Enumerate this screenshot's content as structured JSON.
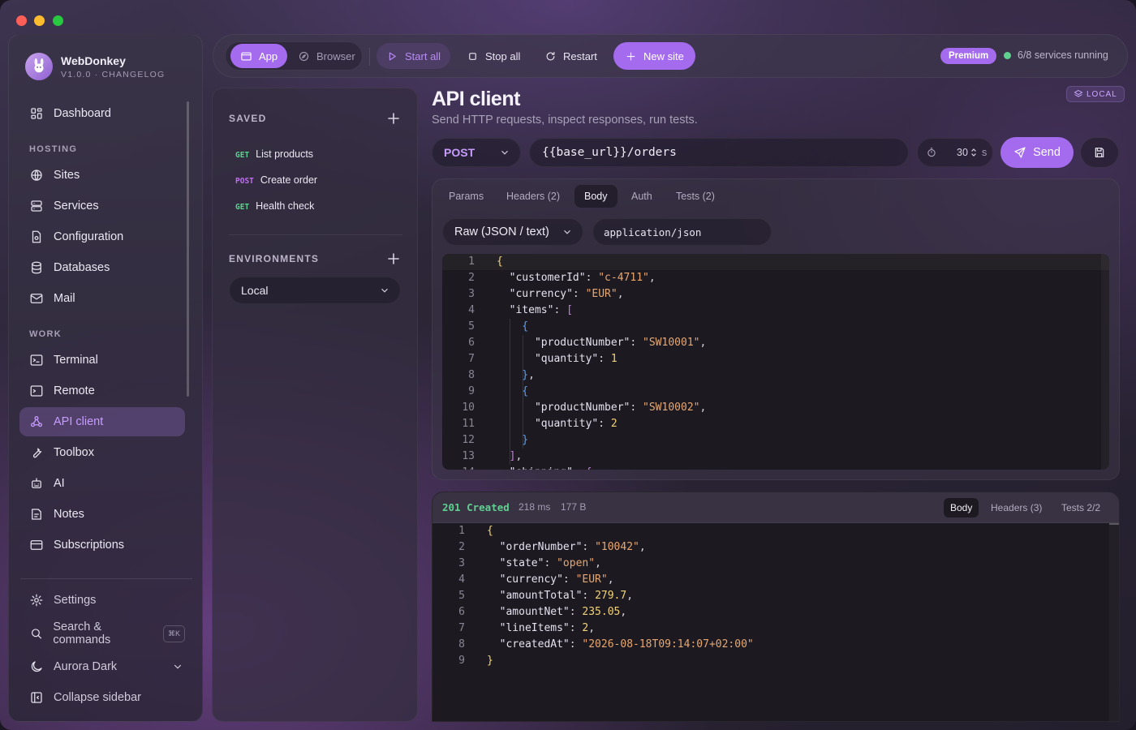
{
  "app": {
    "name": "WebDonkey",
    "version": "V1.0.0 · CHANGELOG"
  },
  "sidebar": {
    "dashboard": "Dashboard",
    "hosting_label": "HOSTING",
    "hosting": [
      "Sites",
      "Services",
      "Configuration",
      "Databases",
      "Mail"
    ],
    "work_label": "WORK",
    "work": [
      "Terminal",
      "Remote",
      "API client",
      "Toolbox",
      "AI",
      "Notes",
      "Subscriptions"
    ],
    "settings": "Settings",
    "search": "Search & commands",
    "search_kbd": "⌘K",
    "theme": "Aurora Dark",
    "collapse": "Collapse sidebar"
  },
  "toolbar": {
    "app": "App",
    "browser": "Browser",
    "start_all": "Start all",
    "stop_all": "Stop all",
    "restart": "Restart",
    "new_site": "New site",
    "premium": "Premium",
    "status": "6/8 services running"
  },
  "saved": {
    "label": "SAVED",
    "items": [
      {
        "method": "GET",
        "name": "List products"
      },
      {
        "method": "POST",
        "name": "Create order"
      },
      {
        "method": "GET",
        "name": "Health check"
      }
    ],
    "env_label": "ENVIRONMENTS",
    "env_value": "Local"
  },
  "page": {
    "title": "API client",
    "subtitle": "Send HTTP requests, inspect responses, run tests.",
    "badge": "LOCAL"
  },
  "request": {
    "method": "POST",
    "url": "{{base_url}}/orders",
    "timeout": "30",
    "timeout_unit": "s",
    "send": "Send",
    "tabs": [
      "Params",
      "Headers (2)",
      "Body",
      "Auth",
      "Tests (2)"
    ],
    "active_tab": "Body",
    "body_type": "Raw (JSON / text)",
    "content_type": "application/json",
    "body_lines": [
      [
        {
          "c": "b1",
          "t": "{"
        }
      ],
      [
        {
          "c": "k",
          "t": "  \"customerId\""
        },
        {
          "c": "p",
          "t": ": "
        },
        {
          "c": "s",
          "t": "\"c-4711\""
        },
        {
          "c": "p",
          "t": ","
        }
      ],
      [
        {
          "c": "k",
          "t": "  \"currency\""
        },
        {
          "c": "p",
          "t": ": "
        },
        {
          "c": "s",
          "t": "\"EUR\""
        },
        {
          "c": "p",
          "t": ","
        }
      ],
      [
        {
          "c": "k",
          "t": "  \"items\""
        },
        {
          "c": "p",
          "t": ": "
        },
        {
          "c": "b2",
          "t": "["
        }
      ],
      [
        {
          "c": "b3",
          "t": "    {"
        }
      ],
      [
        {
          "c": "k",
          "t": "      \"productNumber\""
        },
        {
          "c": "p",
          "t": ": "
        },
        {
          "c": "s",
          "t": "\"SW10001\""
        },
        {
          "c": "p",
          "t": ","
        }
      ],
      [
        {
          "c": "k",
          "t": "      \"quantity\""
        },
        {
          "c": "p",
          "t": ": "
        },
        {
          "c": "n",
          "t": "1"
        }
      ],
      [
        {
          "c": "b3",
          "t": "    }"
        },
        {
          "c": "p",
          "t": ","
        }
      ],
      [
        {
          "c": "b3",
          "t": "    {"
        }
      ],
      [
        {
          "c": "k",
          "t": "      \"productNumber\""
        },
        {
          "c": "p",
          "t": ": "
        },
        {
          "c": "s",
          "t": "\"SW10002\""
        },
        {
          "c": "p",
          "t": ","
        }
      ],
      [
        {
          "c": "k",
          "t": "      \"quantity\""
        },
        {
          "c": "p",
          "t": ": "
        },
        {
          "c": "n",
          "t": "2"
        }
      ],
      [
        {
          "c": "b3",
          "t": "    }"
        }
      ],
      [
        {
          "c": "b2",
          "t": "  ]"
        },
        {
          "c": "p",
          "t": ","
        }
      ],
      [
        {
          "c": "k",
          "t": "  \"shipping\""
        },
        {
          "c": "p",
          "t": ": "
        },
        {
          "c": "b2",
          "t": "{"
        }
      ]
    ]
  },
  "response": {
    "status": "201 Created",
    "time": "218 ms",
    "size": "177 B",
    "tabs": [
      "Body",
      "Headers (3)",
      "Tests 2/2"
    ],
    "active_tab": "Body",
    "lines": [
      [
        {
          "c": "b1",
          "t": "{"
        }
      ],
      [
        {
          "c": "k",
          "t": "  \"orderNumber\""
        },
        {
          "c": "p",
          "t": ": "
        },
        {
          "c": "s",
          "t": "\"10042\""
        },
        {
          "c": "p",
          "t": ","
        }
      ],
      [
        {
          "c": "k",
          "t": "  \"state\""
        },
        {
          "c": "p",
          "t": ": "
        },
        {
          "c": "s",
          "t": "\"open\""
        },
        {
          "c": "p",
          "t": ","
        }
      ],
      [
        {
          "c": "k",
          "t": "  \"currency\""
        },
        {
          "c": "p",
          "t": ": "
        },
        {
          "c": "s",
          "t": "\"EUR\""
        },
        {
          "c": "p",
          "t": ","
        }
      ],
      [
        {
          "c": "k",
          "t": "  \"amountTotal\""
        },
        {
          "c": "p",
          "t": ": "
        },
        {
          "c": "n",
          "t": "279.7"
        },
        {
          "c": "p",
          "t": ","
        }
      ],
      [
        {
          "c": "k",
          "t": "  \"amountNet\""
        },
        {
          "c": "p",
          "t": ": "
        },
        {
          "c": "n",
          "t": "235.05"
        },
        {
          "c": "p",
          "t": ","
        }
      ],
      [
        {
          "c": "k",
          "t": "  \"lineItems\""
        },
        {
          "c": "p",
          "t": ": "
        },
        {
          "c": "n",
          "t": "2"
        },
        {
          "c": "p",
          "t": ","
        }
      ],
      [
        {
          "c": "k",
          "t": "  \"createdAt\""
        },
        {
          "c": "p",
          "t": ": "
        },
        {
          "c": "s",
          "t": "\"2026-08-18T09:14:07+02:00\""
        }
      ],
      [
        {
          "c": "b1",
          "t": "}"
        }
      ]
    ]
  },
  "colors": {
    "accent": "#a66ef0",
    "get": "#5fd08f",
    "post": "#c06ff0",
    "status_ok": "#5fd08f"
  }
}
